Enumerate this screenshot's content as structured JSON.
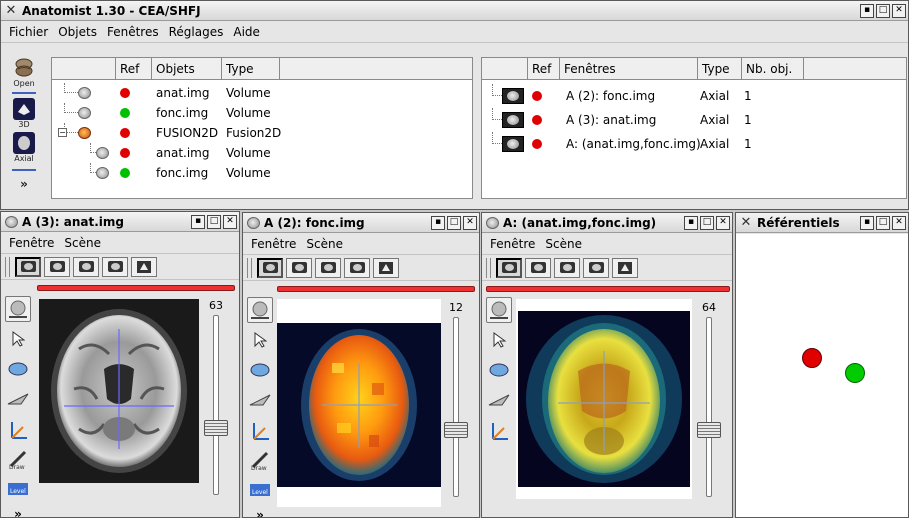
{
  "main": {
    "title": "Anatomist 1.30 - CEA/SHFJ",
    "menu": [
      "Fichier",
      "Objets",
      "Fenêtres",
      "Réglages",
      "Aide"
    ],
    "tools": [
      {
        "label": "Open",
        "icon": "open-icon"
      },
      {
        "label": "3D",
        "icon": "3d-window-icon"
      },
      {
        "label": "Axial",
        "icon": "axial-window-icon"
      }
    ],
    "objects_table": {
      "headers": [
        "Ref",
        "Objets",
        "Type"
      ],
      "rows": [
        {
          "name": "anat.img",
          "type": "Volume",
          "ref_color": "#e00000",
          "level": 0,
          "icon": "brain-volume-icon"
        },
        {
          "name": "fonc.img",
          "type": "Volume",
          "ref_color": "#00c000",
          "level": 0,
          "icon": "brain-volume-icon"
        },
        {
          "name": "FUSION2D",
          "type": "Fusion2D",
          "ref_color": "#e00000",
          "level": 0,
          "icon": "fusion-icon",
          "expanded": true
        },
        {
          "name": "anat.img",
          "type": "Volume",
          "ref_color": "#e00000",
          "level": 1,
          "icon": "brain-volume-icon"
        },
        {
          "name": "fonc.img",
          "type": "Volume",
          "ref_color": "#00c000",
          "level": 1,
          "icon": "brain-volume-icon"
        }
      ]
    },
    "windows_table": {
      "headers": [
        "Ref",
        "Fenêtres",
        "Type",
        "Nb. obj."
      ],
      "rows": [
        {
          "name": "A (2): fonc.img",
          "type": "Axial",
          "count": "1",
          "ref_color": "#e00000"
        },
        {
          "name": "A (3): anat.img",
          "type": "Axial",
          "count": "1",
          "ref_color": "#e00000"
        },
        {
          "name": "A: (anat.img,fonc.img)",
          "type": "Axial",
          "count": "1",
          "ref_color": "#e00000"
        }
      ]
    }
  },
  "views": [
    {
      "title": "A (3): anat.img",
      "menu": [
        "Fenêtre",
        "Scène"
      ],
      "slice": "63",
      "slice_fraction": 0.36
    },
    {
      "title": "A (2): fonc.img",
      "menu": [
        "Fenêtre",
        "Scène"
      ],
      "slice": "12",
      "slice_fraction": 0.36
    },
    {
      "title": "A: (anat.img,fonc.img)",
      "menu": [
        "Fenêtre",
        "Scène"
      ],
      "slice": "64",
      "slice_fraction": 0.36
    }
  ],
  "referentials": {
    "title": "Référentiels",
    "dots": [
      {
        "name": "red-referential",
        "color": "#e00000"
      },
      {
        "name": "green-referential",
        "color": "#00cc00"
      }
    ]
  }
}
